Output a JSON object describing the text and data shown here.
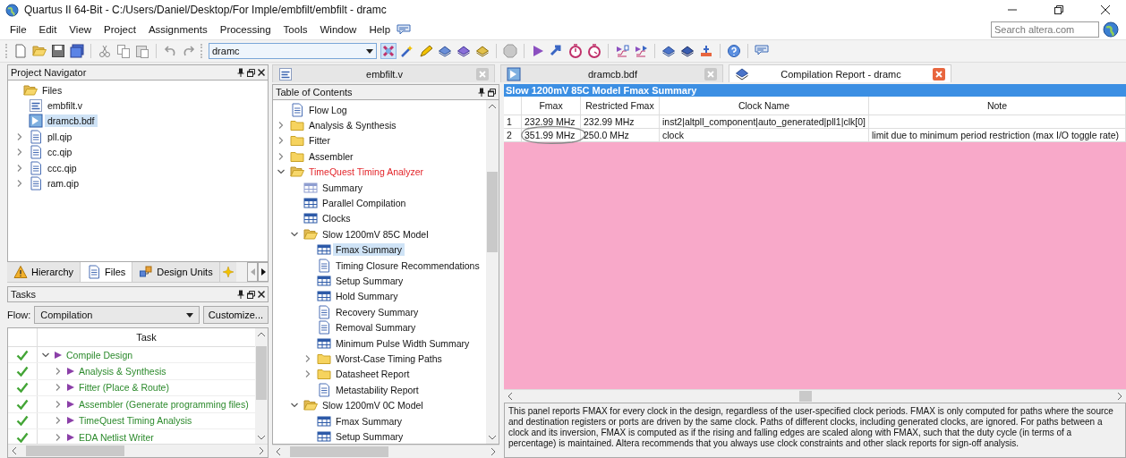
{
  "window": {
    "title": "Quartus II 64-Bit - C:/Users/Daniel/Desktop/For Imple/embfilt/embfilt - dramc"
  },
  "menu": [
    "File",
    "Edit",
    "View",
    "Project",
    "Assignments",
    "Processing",
    "Tools",
    "Window",
    "Help"
  ],
  "search": {
    "placeholder": "Search altera.com"
  },
  "toolbar": {
    "entity_combo": "dramc"
  },
  "project_navigator": {
    "title": "Project Navigator",
    "tree": [
      {
        "label": "Files",
        "kind": "folder",
        "selected": false,
        "children": [
          {
            "label": "embfilt.v",
            "kind": "verilog",
            "selected": false
          },
          {
            "label": "dramcb.bdf",
            "kind": "bdf",
            "selected": true
          },
          {
            "label": "pll.qip",
            "kind": "doc",
            "selected": false,
            "expanded": false
          },
          {
            "label": "cc.qip",
            "kind": "doc",
            "selected": false,
            "expanded": false
          },
          {
            "label": "ccc.qip",
            "kind": "doc",
            "selected": false,
            "expanded": false
          },
          {
            "label": "ram.qip",
            "kind": "doc",
            "selected": false,
            "expanded": false
          }
        ]
      }
    ],
    "tabs": [
      {
        "label": "Hierarchy",
        "kind": "hierarchy",
        "selected": false
      },
      {
        "label": "Files",
        "kind": "files",
        "selected": true
      },
      {
        "label": "Design Units",
        "kind": "units",
        "selected": false
      }
    ]
  },
  "tasks": {
    "title": "Tasks",
    "flow_label": "Flow:",
    "flow": "Compilation",
    "customize_button": "Customize...",
    "column": "Task",
    "rows": [
      {
        "label": "Compile Design",
        "done": true,
        "expanded": true,
        "children": [
          {
            "label": "Analysis & Synthesis",
            "done": true,
            "expanded": false
          },
          {
            "label": "Fitter (Place & Route)",
            "done": true,
            "expanded": false
          },
          {
            "label": "Assembler (Generate programming files)",
            "done": true,
            "expanded": false
          },
          {
            "label": "TimeQuest Timing Analysis",
            "done": true,
            "expanded": false
          },
          {
            "label": "EDA Netlist Writer",
            "done": true,
            "expanded": false
          }
        ]
      }
    ]
  },
  "document_tabs": [
    {
      "label": "embfilt.v",
      "kind": "verilog",
      "selected": false
    },
    {
      "label": "dramcb.bdf",
      "kind": "bdf",
      "selected": false
    },
    {
      "label": "Compilation Report - dramc",
      "kind": "report",
      "selected": true
    }
  ],
  "toc": {
    "title": "Table of Contents",
    "tree": [
      {
        "label": "Flow Log",
        "kind": "doc",
        "selected": false
      },
      {
        "label": "Analysis & Synthesis",
        "kind": "folder",
        "selected": false,
        "expanded": false
      },
      {
        "label": "Fitter",
        "kind": "folder",
        "selected": false,
        "expanded": false
      },
      {
        "label": "Assembler",
        "kind": "folder",
        "selected": false,
        "expanded": false
      },
      {
        "label": "TimeQuest Timing Analyzer",
        "kind": "folder",
        "selected": false,
        "expanded": true,
        "highlighted": true,
        "children": [
          {
            "label": "Summary",
            "kind": "table-light",
            "selected": false
          },
          {
            "label": "Parallel Compilation",
            "kind": "table",
            "selected": false
          },
          {
            "label": "Clocks",
            "kind": "table",
            "selected": false
          },
          {
            "label": "Slow 1200mV 85C Model",
            "kind": "folder",
            "selected": false,
            "expanded": true,
            "children": [
              {
                "label": "Fmax Summary",
                "kind": "table",
                "selected": true
              },
              {
                "label": "Timing Closure Recommendations",
                "kind": "doc",
                "selected": false
              },
              {
                "label": "Setup Summary",
                "kind": "table",
                "selected": false
              },
              {
                "label": "Hold Summary",
                "kind": "table",
                "selected": false
              },
              {
                "label": "Recovery Summary",
                "kind": "doc",
                "selected": false
              },
              {
                "label": "Removal Summary",
                "kind": "doc",
                "selected": false
              },
              {
                "label": "Minimum Pulse Width Summary",
                "kind": "table",
                "selected": false
              },
              {
                "label": "Worst-Case Timing Paths",
                "kind": "folder",
                "selected": false,
                "expanded": false
              },
              {
                "label": "Datasheet Report",
                "kind": "folder",
                "selected": false,
                "expanded": false
              },
              {
                "label": "Metastability Report",
                "kind": "doc",
                "selected": false
              }
            ]
          },
          {
            "label": "Slow 1200mV 0C Model",
            "kind": "folder",
            "selected": false,
            "expanded": true,
            "children": [
              {
                "label": "Fmax Summary",
                "kind": "table",
                "selected": false
              },
              {
                "label": "Setup Summary",
                "kind": "table",
                "selected": false
              }
            ]
          }
        ]
      }
    ]
  },
  "report": {
    "title": "Slow 1200mV 85C Model Fmax Summary",
    "columns": [
      "Fmax",
      "Restricted Fmax",
      "Clock Name",
      "Note"
    ],
    "rows": [
      {
        "number": "1",
        "cells": [
          "232.99 MHz",
          "232.99 MHz",
          "inst2|altpll_component|auto_generated|pll1|clk[0]"
        ],
        "circled": false
      },
      {
        "number": "2",
        "cells": [
          "351.99 MHz",
          "250.0 MHz",
          "clock",
          "limit due to minimum period restriction (max I/O toggle rate)"
        ],
        "circled": true
      }
    ],
    "description": "This panel reports FMAX for every clock in the design, regardless of the user-specified clock periods.  FMAX is only computed for paths where the source and destination registers or ports are driven by the same clock.  Paths of different clocks, including generated clocks, are ignored.  For paths between a clock and its inversion, FMAX is computed as if the rising and falling edges are scaled along with FMAX, such that the duty cycle (in terms of a percentage) is maintained.  Altera recommends that you always use clock constraints and other slack reports for sign-off analysis."
  }
}
